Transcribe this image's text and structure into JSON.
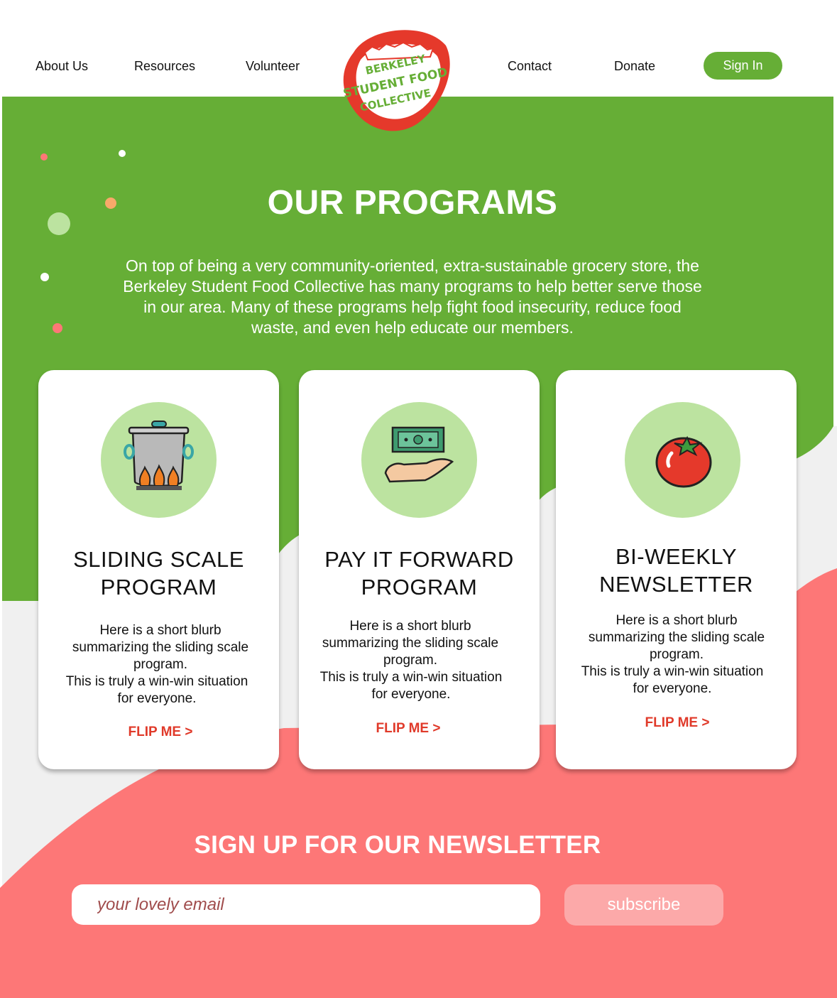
{
  "colors": {
    "green": "#66ae36",
    "light_green": "#bce3a0",
    "coral": "#fd7777",
    "light_grey": "#f0f0f0",
    "red_text": "#e03a2a",
    "button_pink": "#fca9a9"
  },
  "nav": {
    "left": [
      "About Us",
      "Resources",
      "Volunteer"
    ],
    "right": [
      "Contact",
      "Donate"
    ],
    "signin_label": "Sign In"
  },
  "logo": {
    "line1": "BERKELEY",
    "line2": "STUDENT FOOD",
    "line3": "COLLECTIVE"
  },
  "hero": {
    "title": "OUR PROGRAMS",
    "intro": "On top of being a very community-oriented, extra-sustainable grocery store, the Berkeley Student Food Collective has many programs to help better serve those in our area. Many of these programs help fight food insecurity, reduce food waste, and even help educate our members."
  },
  "cards": [
    {
      "icon": "cooking-pot-icon",
      "title_line1": "SLIDING SCALE",
      "title_line2": "PROGRAM",
      "blurb_a": "Here is a short blurb summarizing the sliding scale program.",
      "blurb_b": "This is truly a win-win situation for everyone.",
      "flip": "FLIP ME  >"
    },
    {
      "icon": "hand-money-icon",
      "title_line1": "PAY IT FORWARD",
      "title_line2": "PROGRAM",
      "blurb_a": "Here is a short blurb summarizing the sliding scale program.",
      "blurb_b": "This is truly a win-win situation for everyone.",
      "flip": "FLIP ME  >"
    },
    {
      "icon": "tomato-icon",
      "title_line1": "BI-WEEKLY",
      "title_line2": "NEWSLETTER",
      "blurb_a": "Here is a short blurb summarizing the sliding scale program.",
      "blurb_b": "This is truly a win-win situation for everyone.",
      "flip": "FLIP ME  >"
    }
  ],
  "newsletter": {
    "title": "SIGN UP FOR OUR NEWSLETTER",
    "placeholder": "your lovely email",
    "button": "subscribe"
  }
}
